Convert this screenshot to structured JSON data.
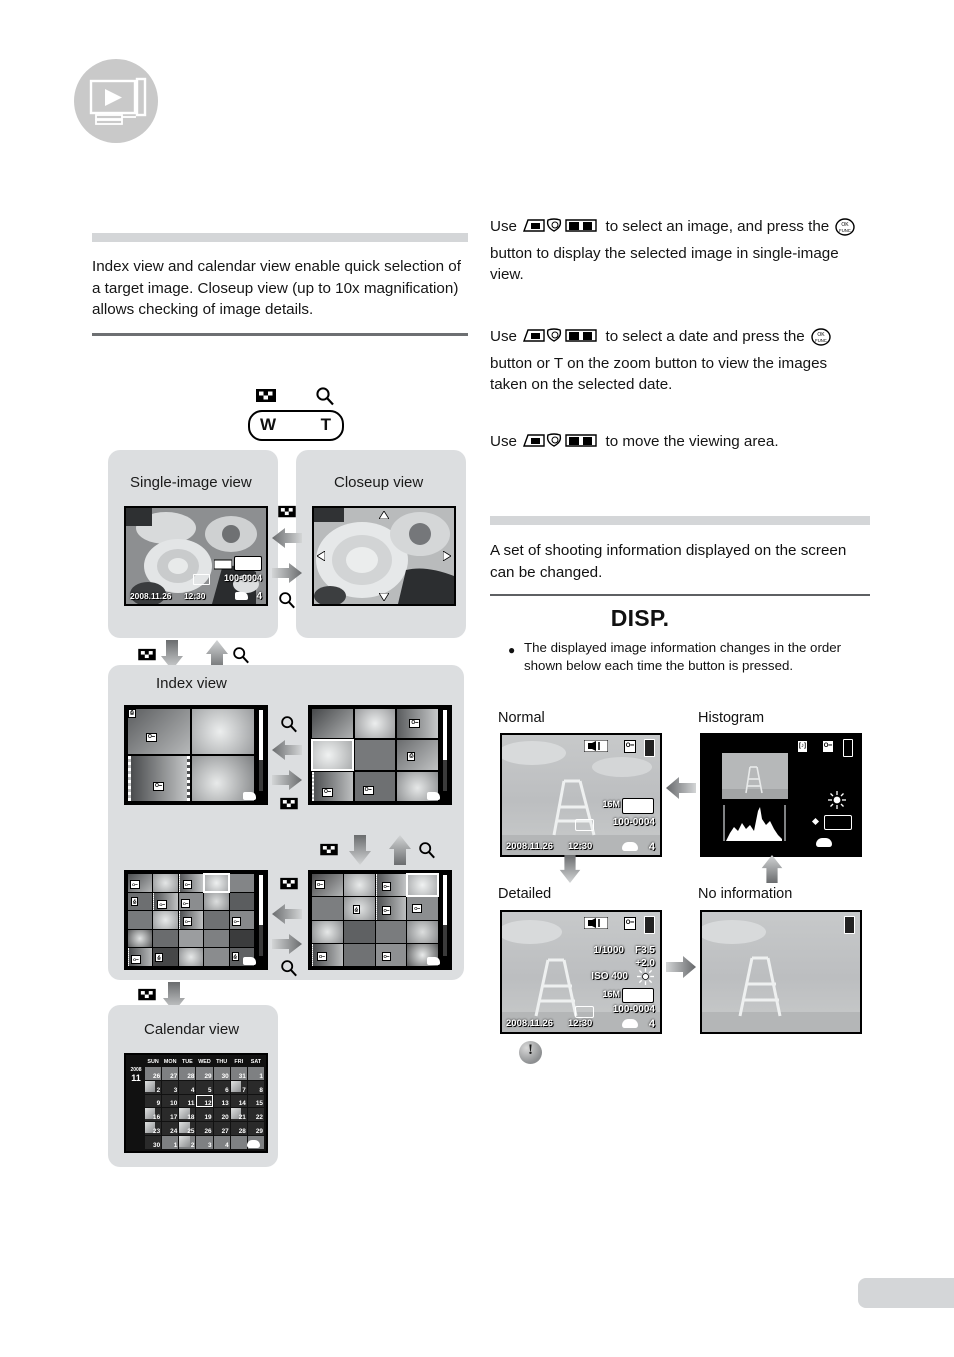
{
  "header": {
    "icon": "playback-mode-icon"
  },
  "left": {
    "intro": "Index view and calendar view enable quick selection of a target image. Closeup view (up to 10x magnification) allows checking of image details.",
    "zoom_lever": {
      "wide_label": "W",
      "tele_label": "T",
      "left_icon": "index-view-icon",
      "right_icon": "magnifier-icon"
    },
    "panels": {
      "single": "Single-image view",
      "closeup": "Closeup view",
      "index": "Index view",
      "calendar": "Calendar view"
    },
    "single_screen": {
      "date": "2008.11.26",
      "time": "12:30",
      "file_no": "100-0004",
      "count": "4"
    },
    "calendar_screen": {
      "year": "2008",
      "month": "11",
      "weekdays": [
        "SUN",
        "MON",
        "TUE",
        "WED",
        "THU",
        "FRI",
        "SAT"
      ],
      "weeks": [
        [
          "26",
          "27",
          "28",
          "29",
          "30",
          "31",
          "1"
        ],
        [
          "2",
          "3",
          "4",
          "5",
          "6",
          "7",
          "8"
        ],
        [
          "9",
          "10",
          "11",
          "12",
          "13",
          "14",
          "15"
        ],
        [
          "16",
          "17",
          "18",
          "19",
          "20",
          "21",
          "22"
        ],
        [
          "23",
          "24",
          "25",
          "26",
          "27",
          "28",
          "29"
        ],
        [
          "30",
          "1",
          "2",
          "3",
          "4",
          "",
          ""
        ]
      ],
      "selected_day": "12"
    }
  },
  "right": {
    "para1": "to select an image, and press the",
    "para1_lead": "Use",
    "para1_tail": "button to display the selected image in single-image view.",
    "para2_lead": "Use",
    "para2_mid": "to select a date and press the",
    "para2_tail": "button or T on the zoom button to view the images taken on the selected date.",
    "para3_lead": "Use",
    "para3_tail": "to move the viewing area.",
    "section2_text": "A set of shooting information displayed on the screen can be changed.",
    "disp_title": "DISP.",
    "bullet": "The displayed image information changes in the order shown below each time the button is pressed.",
    "screens": {
      "normal": "Normal",
      "histogram": "Histogram",
      "detailed": "Detailed",
      "none": "No information"
    },
    "normal_screen": {
      "date": "2008.11.26",
      "time": "12:30",
      "file_no": "100-0004",
      "count": "4"
    },
    "detailed_screen": {
      "shutter": "1/1000",
      "aperture": "F3.5",
      "exposure": "+2.0",
      "iso": "ISO 400",
      "file_no": "100-0004",
      "date": "2008.11.26",
      "time": "12:30",
      "count": "4"
    },
    "note_icon": "caution-note-icon"
  }
}
